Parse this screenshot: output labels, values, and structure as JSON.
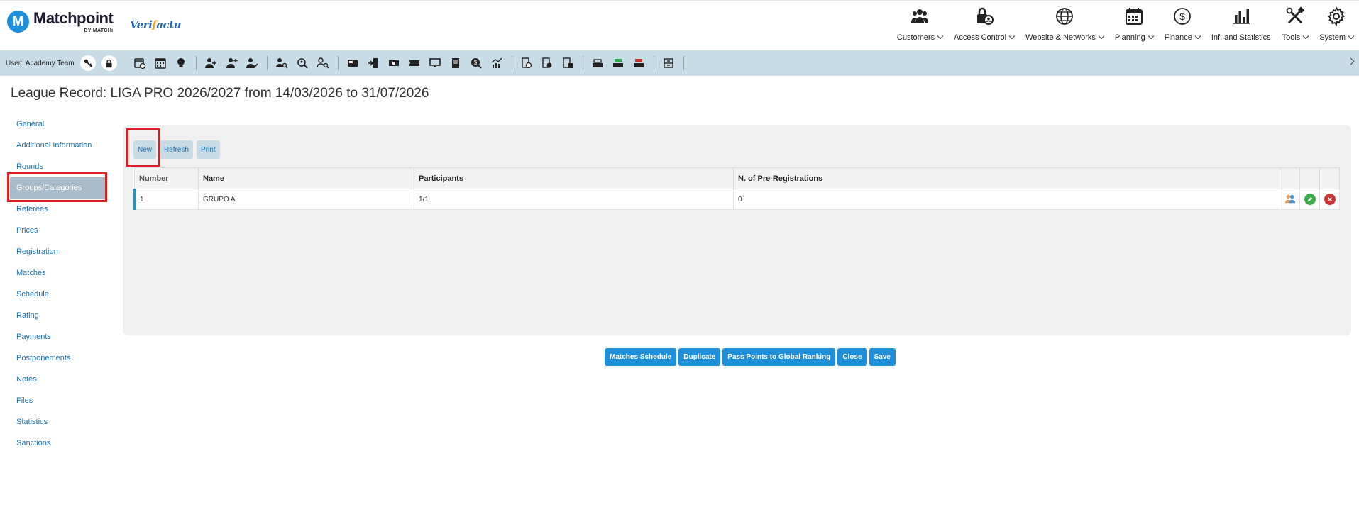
{
  "brand": {
    "badge": "M",
    "name": "Matchpoint",
    "sub": "BY MATCHi",
    "partner_a": "Veri",
    "partner_check": "f",
    "partner_b": "actu"
  },
  "nav": [
    {
      "label": "Customers",
      "icon": "customers-icon"
    },
    {
      "label": "Access Control",
      "icon": "access-control-icon"
    },
    {
      "label": "Website & Networks",
      "icon": "globe-icon"
    },
    {
      "label": "Planning",
      "icon": "calendar-icon"
    },
    {
      "label": "Finance",
      "icon": "dollar-icon"
    },
    {
      "label": "Inf. and Statistics",
      "icon": "bar-chart-icon"
    },
    {
      "label": "Tools",
      "icon": "tools-icon"
    },
    {
      "label": "System",
      "icon": "gear-icon"
    }
  ],
  "toolbar": {
    "user_label": "User:",
    "user_name": "Academy Team"
  },
  "page": {
    "title": "League Record: LIGA PRO 2026/2027 from 14/03/2026 to 31/07/2026"
  },
  "sidebar": {
    "items": [
      {
        "label": "General",
        "active": false
      },
      {
        "label": "Additional Information",
        "active": false
      },
      {
        "label": "Rounds",
        "active": false
      },
      {
        "label": "Groups/Categories",
        "active": true
      },
      {
        "label": "Referees",
        "active": false
      },
      {
        "label": "Prices",
        "active": false
      },
      {
        "label": "Registration",
        "active": false
      },
      {
        "label": "Matches",
        "active": false
      },
      {
        "label": "Schedule",
        "active": false
      },
      {
        "label": "Rating",
        "active": false
      },
      {
        "label": "Payments",
        "active": false
      },
      {
        "label": "Postponements",
        "active": false
      },
      {
        "label": "Notes",
        "active": false
      },
      {
        "label": "Files",
        "active": false
      },
      {
        "label": "Statistics",
        "active": false
      },
      {
        "label": "Sanctions",
        "active": false
      }
    ]
  },
  "actions": {
    "new": "New",
    "refresh": "Refresh",
    "print": "Print"
  },
  "table": {
    "columns": [
      "Number",
      "Name",
      "Participants",
      "N. of Pre-Registrations"
    ],
    "rows": [
      {
        "number": "1",
        "name": "GRUPO A",
        "participants": "1/1",
        "pre_registrations": "0"
      }
    ]
  },
  "bottom": {
    "matches_schedule": "Matches Schedule",
    "duplicate": "Duplicate",
    "pass_points": "Pass Points to Global Ranking",
    "close": "Close",
    "save": "Save"
  },
  "colors": {
    "accent": "#1e8fd8",
    "toolbar_bg": "#c8dce7",
    "highlight": "#e02020",
    "link": "#1a73b5"
  }
}
